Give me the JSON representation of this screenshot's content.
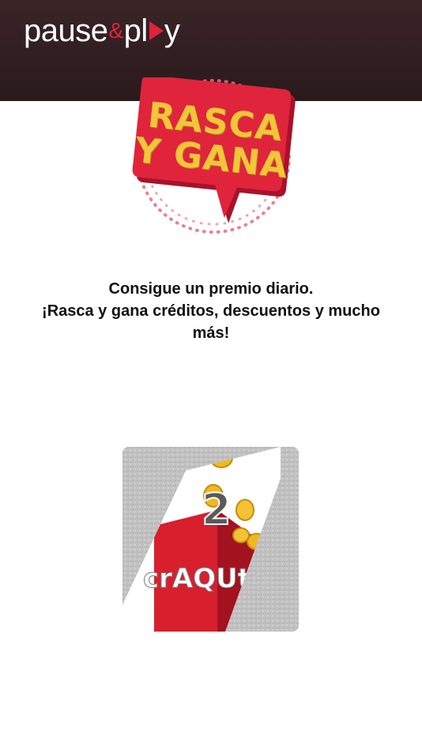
{
  "header": {
    "logo": {
      "word1": "pause",
      "amp": "&",
      "word2_start": "pl",
      "word2_end": "y"
    }
  },
  "badge": {
    "line1": "RASCA",
    "line2": "Y GANA"
  },
  "copy": {
    "line1": "Consigue un premio diario.",
    "line2": "¡Rasca y gana créditos, descuentos y mucho más!"
  },
  "scratch_card": {
    "number": "2",
    "partial_text": "crAQUto"
  },
  "colors": {
    "header_bg": "#2f1e20",
    "brand_red": "#e2223a",
    "badge_yellow": "#f2c63a",
    "card_gray": "#bdbdbd",
    "coin_gold": "#f0b820"
  }
}
